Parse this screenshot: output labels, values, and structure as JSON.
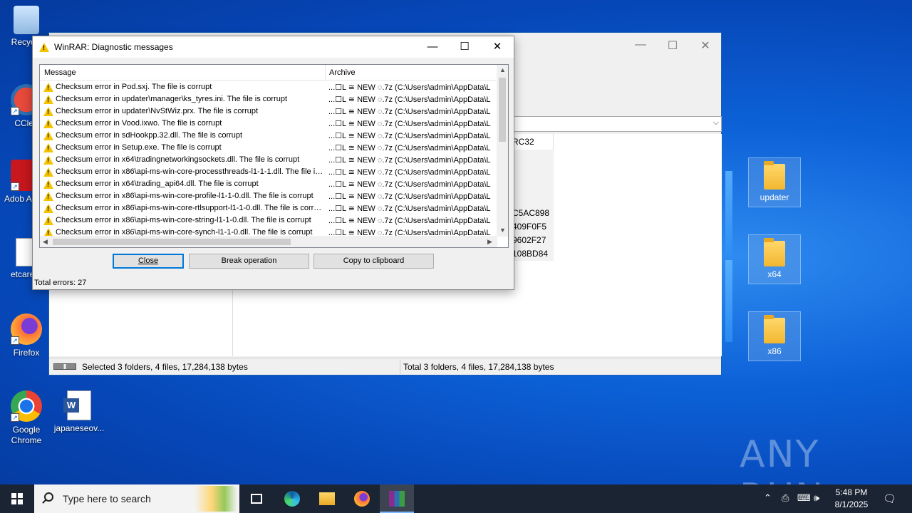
{
  "desktop": {
    "icons": [
      {
        "label": "Recycle"
      },
      {
        "label": "CClea"
      },
      {
        "label": "Adob Acrob"
      },
      {
        "label": "etcareer"
      },
      {
        "label": "Firefox"
      },
      {
        "label": "Google Chrome"
      },
      {
        "label": "japaneseov..."
      }
    ],
    "folders": [
      {
        "label": "updater"
      },
      {
        "label": "x64"
      },
      {
        "label": "x86"
      }
    ],
    "watermark": "ANY RUN"
  },
  "bg_window": {
    "col_header": "RC32",
    "crc_values": [
      "C5AC898",
      "409F0F5",
      "9602F27",
      "108BD84"
    ],
    "status_left": "Selected 3 folders, 4 files, 17,284,138 bytes",
    "status_right": "Total 3 folders, 4 files, 17,284,138 bytes"
  },
  "dialog": {
    "title": "WinRAR: Diagnostic messages",
    "col_message": "Message",
    "col_archive": "Archive",
    "archive_text": "...☐L ≅ NEW ◌.7z (C:\\Users\\admin\\AppData\\L",
    "rows": [
      {
        "msg": "Checksum error in Pod.sxj. The file is corrupt"
      },
      {
        "msg": "Checksum error in updater\\manager\\ks_tyres.ini. The file is corrupt"
      },
      {
        "msg": "Checksum error in updater\\NvStWiz.prx. The file is corrupt"
      },
      {
        "msg": "Checksum error in Vood.ixwo. The file is corrupt"
      },
      {
        "msg": "Checksum error in sdHookpp.32.dll. The file is corrupt"
      },
      {
        "msg": "Checksum error in Setup.exe. The file is corrupt"
      },
      {
        "msg": "Checksum error in x64\\tradingnetworkingsockets.dll. The file is corrupt"
      },
      {
        "msg": "Checksum error in x86\\api-ms-win-core-processthreads-l1-1-1.dll. The file is..."
      },
      {
        "msg": "Checksum error in x64\\trading_api64.dll. The file is corrupt"
      },
      {
        "msg": "Checksum error in x86\\api-ms-win-core-profile-l1-1-0.dll. The file is corrupt"
      },
      {
        "msg": "Checksum error in x86\\api-ms-win-core-rtlsupport-l1-1-0.dll. The file is corrupt"
      },
      {
        "msg": "Checksum error in x86\\api-ms-win-core-string-l1-1-0.dll. The file is corrupt"
      },
      {
        "msg": "Checksum error in x86\\api-ms-win-core-synch-l1-1-0.dll. The file is corrupt"
      }
    ],
    "btn_close": "Close",
    "btn_break": "Break operation",
    "btn_copy": "Copy to clipboard",
    "total": "Total errors: 27"
  },
  "taskbar": {
    "search_placeholder": "Type here to search",
    "time": "5:48 PM",
    "date": "8/1/2025"
  }
}
